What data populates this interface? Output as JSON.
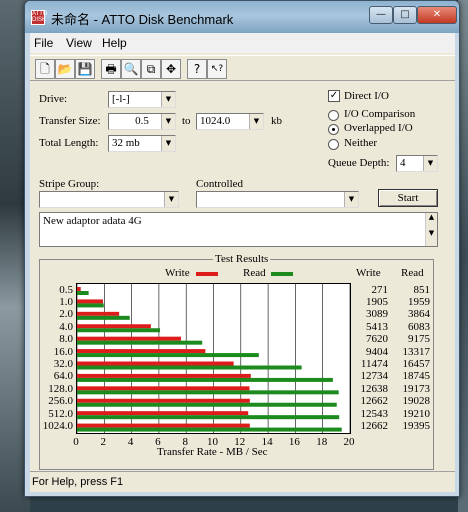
{
  "window": {
    "title": "未命名 - ATTO Disk Benchmark",
    "app_icon_text": "ATTO DISK",
    "minimize_glyph": "—",
    "maximize_glyph": "□",
    "close_glyph": "✕"
  },
  "menu": [
    "File",
    "View",
    "Help"
  ],
  "toolbar": [
    {
      "name": "new-icon",
      "glyph": "🗋"
    },
    {
      "name": "open-icon",
      "glyph": "📂"
    },
    {
      "name": "save-icon",
      "glyph": "💾"
    },
    {
      "name": "print-icon",
      "glyph": "🖶"
    },
    {
      "name": "print-preview-icon",
      "glyph": "🔍"
    },
    {
      "name": "copy-icon",
      "glyph": "⧉"
    },
    {
      "name": "move-icon",
      "glyph": "✥"
    },
    {
      "name": "help-icon",
      "glyph": "?"
    },
    {
      "name": "context-help-icon",
      "glyph": "↖?"
    }
  ],
  "form": {
    "drive_label": "Drive:",
    "drive_value": "[-l-]",
    "transfer_size_label": "Transfer Size:",
    "transfer_from": "0.5",
    "to_label": "to",
    "transfer_to": "1024.0",
    "kb_label": "kb",
    "total_length_label": "Total Length:",
    "total_length_value": "32 mb",
    "direct_io_label": "Direct I/O",
    "direct_io_checked": true,
    "io_comparison_label": "I/O Comparison",
    "overlapped_io_label": "Overlapped I/O",
    "neither_label": "Neither",
    "selected_mode": "Overlapped I/O",
    "queue_depth_label": "Queue Depth:",
    "queue_depth_value": "4",
    "stripe_group_label": "Stripe Group:",
    "stripe_group_value": "",
    "controlled_label": "Controlled",
    "controlled_value": "",
    "start_label": "Start",
    "description": "New adaptor adata 4G"
  },
  "results": {
    "title": "Test Results",
    "legend_write": "Write",
    "legend_read": "Read",
    "col_write": "Write",
    "col_read": "Read",
    "rows": [
      {
        "size": "0.5",
        "write": "271",
        "read": "851"
      },
      {
        "size": "1.0",
        "write": "1905",
        "read": "1959"
      },
      {
        "size": "2.0",
        "write": "3089",
        "read": "3864"
      },
      {
        "size": "4.0",
        "write": "5413",
        "read": "6083"
      },
      {
        "size": "8.0",
        "write": "7620",
        "read": "9175"
      },
      {
        "size": "16.0",
        "write": "9404",
        "read": "13317"
      },
      {
        "size": "32.0",
        "write": "11474",
        "read": "16457"
      },
      {
        "size": "64.0",
        "write": "12734",
        "read": "18745"
      },
      {
        "size": "128.0",
        "write": "12638",
        "read": "19173"
      },
      {
        "size": "256.0",
        "write": "12662",
        "read": "19028"
      },
      {
        "size": "512.0",
        "write": "12543",
        "read": "19210"
      },
      {
        "size": "1024.0",
        "write": "12662",
        "read": "19395"
      }
    ]
  },
  "chart_data": {
    "type": "bar",
    "orientation": "horizontal",
    "categories": [
      "0.5",
      "1.0",
      "2.0",
      "4.0",
      "8.0",
      "16.0",
      "32.0",
      "64.0",
      "128.0",
      "256.0",
      "512.0",
      "1024.0"
    ],
    "series": [
      {
        "name": "Write",
        "color": "#dd1c1c",
        "values": [
          0.271,
          1.905,
          3.089,
          5.413,
          7.62,
          9.404,
          11.474,
          12.734,
          12.638,
          12.662,
          12.543,
          12.662
        ]
      },
      {
        "name": "Read",
        "color": "#1c8a1c",
        "values": [
          0.851,
          1.959,
          3.864,
          6.083,
          9.175,
          13.317,
          16.457,
          18.745,
          19.173,
          19.028,
          19.21,
          19.395
        ]
      }
    ],
    "xlabel": "Transfer Rate - MB / Sec",
    "xlim": [
      0,
      20
    ],
    "xticks": [
      0,
      2,
      4,
      6,
      8,
      10,
      12,
      14,
      16,
      18,
      20
    ],
    "grid": true
  },
  "status": {
    "text": "For Help, press F1"
  }
}
